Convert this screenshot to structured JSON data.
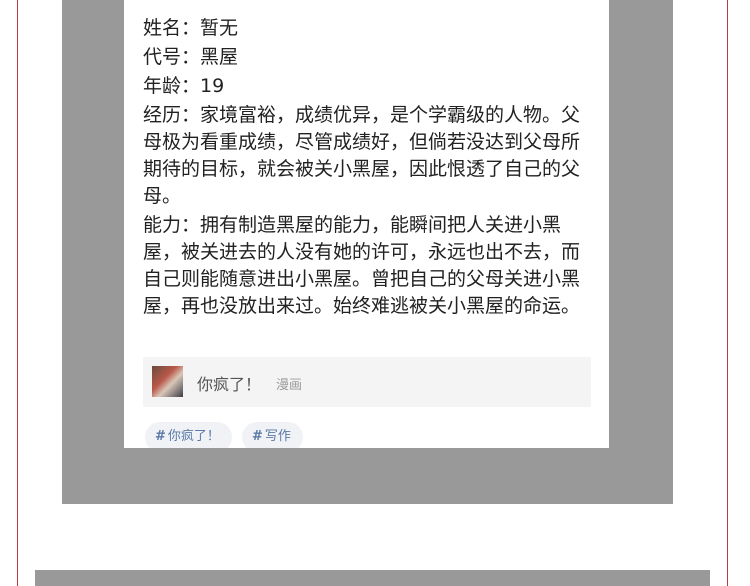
{
  "profile": {
    "heading": "",
    "name_label": "姓名：",
    "name_value": "暂无",
    "code_label": "代号：",
    "code_value": "黑屋",
    "age_label": "年龄：",
    "age_value": "19",
    "history_label": "经历：",
    "history_value": "家境富裕，成绩优异，是个学霸级的人物。父母极为看重成绩，尽管成绩好，但倘若没达到父母所期待的目标，就会被关小黑屋，因此恨透了自己的父母。",
    "ability_label": "能力：",
    "ability_value": "拥有制造黑屋的能力，能瞬间把人关进小黑屋，被关进去的人没有她的许可，永远也出不去，而自己则能随意进出小黑屋。曾把自己的父母关进小黑屋，再也没放出来过。始终难逃被关小黑屋的命运。"
  },
  "source": {
    "thumbnail_icon": "comic-cover-thumbnail",
    "title": "你疯了！",
    "type": "漫画"
  },
  "tags": [
    {
      "label": "你疯了！"
    },
    {
      "label": "写作"
    }
  ],
  "colors": {
    "frame_gray": "#999999",
    "border_red": "#c03a44",
    "tag_text": "#5b7aa8"
  }
}
